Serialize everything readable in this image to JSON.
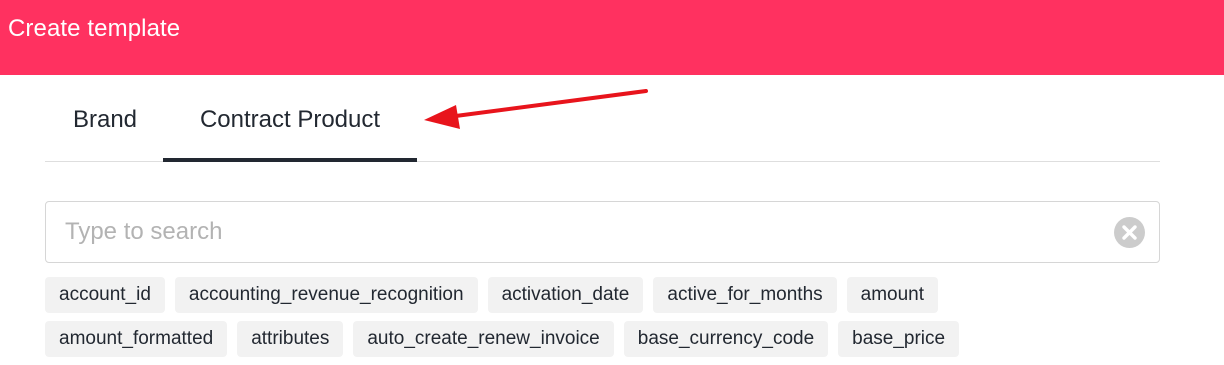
{
  "header": {
    "title": "Create template",
    "background_color": "#ff3160"
  },
  "tabs": [
    {
      "label": "Brand",
      "active": false
    },
    {
      "label": "Contract Product",
      "active": true
    }
  ],
  "annotation": {
    "arrow_color": "#e8141c",
    "points_to": "Contract Product"
  },
  "search": {
    "value": "",
    "placeholder": "Type to search",
    "clear_icon": "clear-circle-icon"
  },
  "chips": {
    "row1": [
      "account_id",
      "accounting_revenue_recognition",
      "activation_date",
      "active_for_months",
      "amount"
    ],
    "row2": [
      "amount_formatted",
      "attributes",
      "auto_create_renew_invoice",
      "base_currency_code",
      "base_price"
    ]
  }
}
